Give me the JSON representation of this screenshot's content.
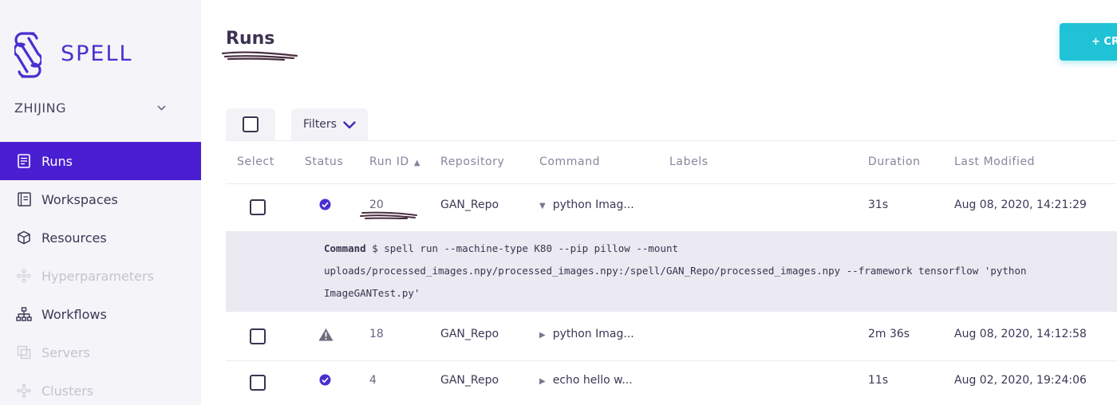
{
  "brand": {
    "name": "SPELL",
    "color": "#4b2fd0"
  },
  "org": {
    "name": "ZHIJING",
    "chevron": "chevron-down-icon"
  },
  "nav": [
    {
      "label": "Runs",
      "icon": "document-icon",
      "active": true,
      "disabled": false
    },
    {
      "label": "Workspaces",
      "icon": "notebook-icon",
      "active": false,
      "disabled": false
    },
    {
      "label": "Resources",
      "icon": "cube-icon",
      "active": false,
      "disabled": false
    },
    {
      "label": "Hyperparameters",
      "icon": "hyperparameters-icon",
      "active": false,
      "disabled": true
    },
    {
      "label": "Workflows",
      "icon": "workflow-icon",
      "active": false,
      "disabled": false
    },
    {
      "label": "Servers",
      "icon": "servers-icon",
      "active": false,
      "disabled": true
    },
    {
      "label": "Clusters",
      "icon": "clusters-icon",
      "active": false,
      "disabled": true
    }
  ],
  "page": {
    "title": "Runs",
    "create_label": "+ CR"
  },
  "toolbar": {
    "filters_label": "Filters"
  },
  "table": {
    "headers": {
      "select": "Select",
      "status": "Status",
      "run_id": "Run ID",
      "repository": "Repository",
      "command": "Command",
      "labels": "Labels",
      "duration": "Duration",
      "last_modified": "Last Modified"
    },
    "rows": [
      {
        "status": "success",
        "run_id": "20",
        "repository": "GAN_Repo",
        "command": "python Imag...",
        "duration": "31s",
        "last_modified": "Aug 08, 2020, 14:21:29",
        "expanded": true
      },
      {
        "status": "warning",
        "run_id": "18",
        "repository": "GAN_Repo",
        "command": "python Imag...",
        "duration": "2m 36s",
        "last_modified": "Aug 08, 2020, 14:12:58",
        "expanded": false
      },
      {
        "status": "success",
        "run_id": "4",
        "repository": "GAN_Repo",
        "command": "echo hello w...",
        "duration": "11s",
        "last_modified": "Aug 02, 2020, 19:24:06",
        "expanded": false
      }
    ],
    "expanded_command": {
      "label": "Command",
      "line1": "$ spell run --machine-type K80 --pip pillow --mount",
      "line2": "uploads/processed_images.npy/processed_images.npy:/spell/GAN_Repo/processed_images.npy --framework tensorflow 'python",
      "line3": "ImageGANTest.py'"
    }
  },
  "colors": {
    "active_nav": "#4a1fd1",
    "create_button": "#20c2d6",
    "success": "#4b2fd0",
    "warning": "#6f6a7c"
  }
}
